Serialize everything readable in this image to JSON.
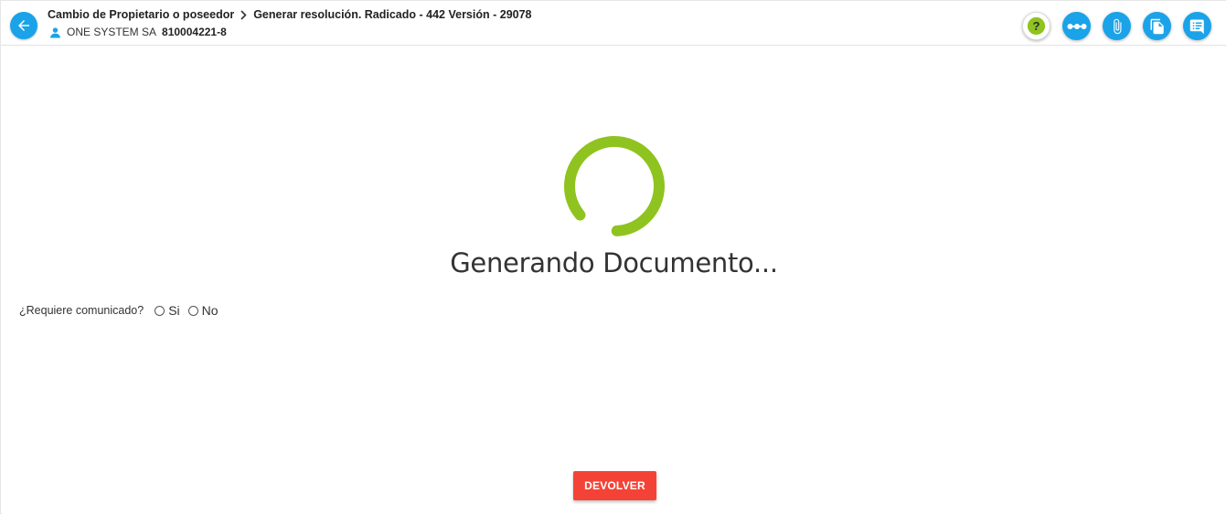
{
  "header": {
    "breadcrumb": {
      "process": "Cambio de Propietario o poseedor",
      "step": "Generar resolución. Radicado - 442 Versión - 29078"
    },
    "owner": {
      "name": "ONE SYSTEM SA",
      "nit": "810004221-8"
    },
    "back_icon": "arrow-left-icon",
    "toolbar": [
      {
        "name": "help",
        "icon": "question-icon"
      },
      {
        "name": "flow",
        "icon": "flow-dots-icon"
      },
      {
        "name": "attachments",
        "icon": "paperclip-icon"
      },
      {
        "name": "documents",
        "icon": "documents-icon"
      },
      {
        "name": "comments",
        "icon": "comment-list-icon"
      }
    ]
  },
  "main": {
    "loading_text": "Generando Documento...",
    "question": {
      "label": "¿Requiere comunicado?",
      "options": [
        "Si",
        "No"
      ]
    },
    "return_button": "DEVOLVER"
  },
  "colors": {
    "primary": "#1aa3e8",
    "spinner": "#8fc31f",
    "help": "#8fc31f",
    "danger": "#f44336"
  }
}
